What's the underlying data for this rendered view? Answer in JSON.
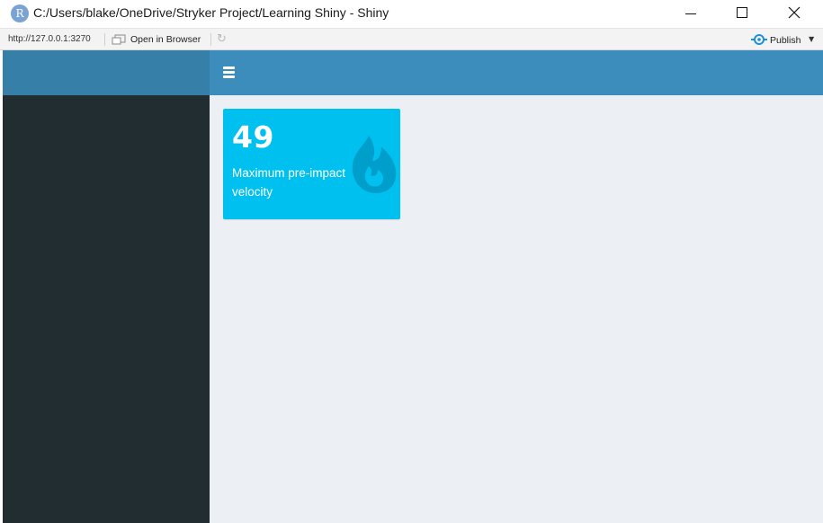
{
  "window": {
    "app_icon_letter": "R",
    "title": "C:/Users/blake/OneDrive/Stryker Project/Learning Shiny - Shiny"
  },
  "toolbar": {
    "url": "http://127.0.0.1:3270",
    "open_in_browser_label": "Open in Browser",
    "publish_label": "Publish"
  },
  "value_box": {
    "value": "49",
    "subtitle": "Maximum pre-impact velocity",
    "icon": "fire-icon",
    "color": "#00c0ef"
  },
  "colors": {
    "header_logo": "#367fa9",
    "header_navbar": "#3c8dbc",
    "sidebar": "#222d32",
    "body": "#ecf0f5"
  }
}
